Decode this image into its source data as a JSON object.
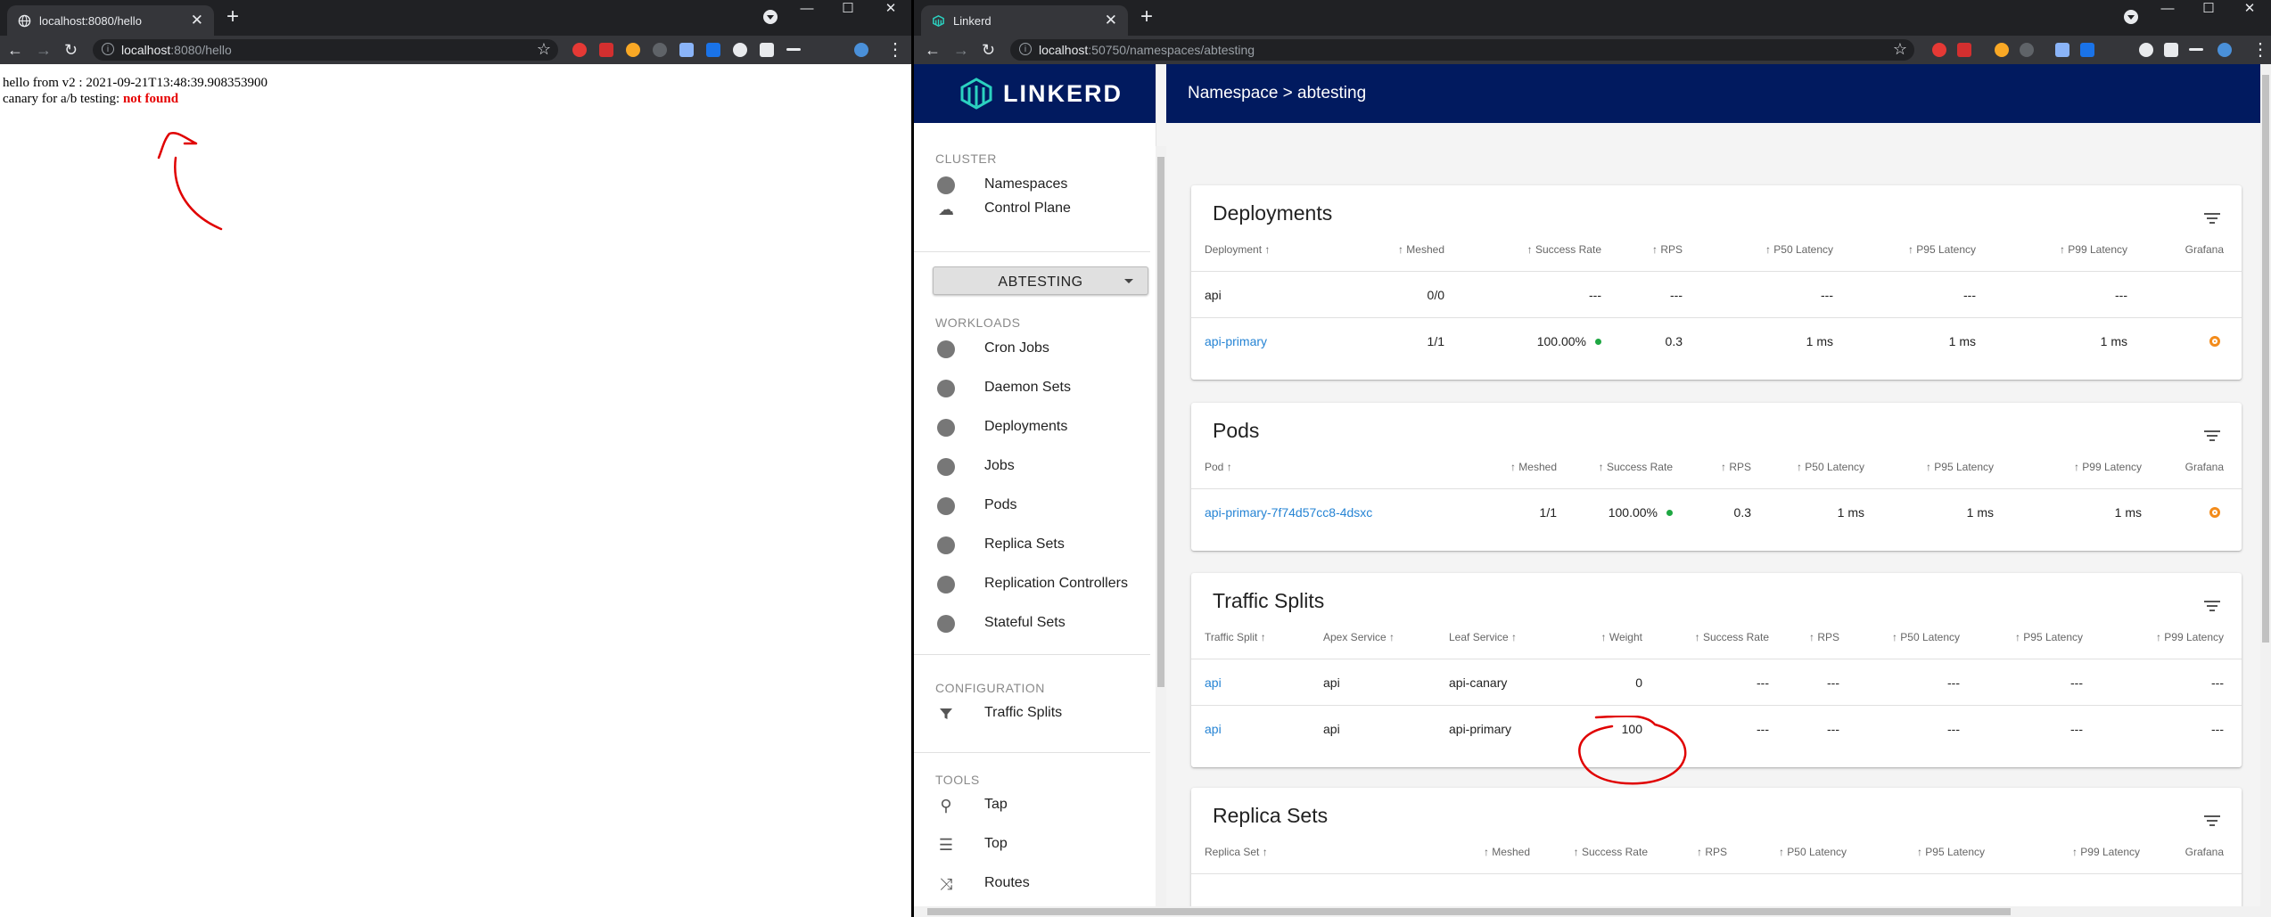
{
  "left_browser": {
    "tab_title": "localhost:8080/hello",
    "address": {
      "host": "localhost",
      "path": ":8080/hello"
    },
    "page": {
      "line1": "hello from v2 : 2021-09-21T13:48:39.908353900",
      "line2_prefix": "canary for a/b testing: ",
      "line2_value": "not found"
    }
  },
  "right_browser": {
    "tab_title": "Linkerd",
    "address": {
      "host": "localhost",
      "path": ":50750/namespaces/abtesting"
    }
  },
  "sidebar": {
    "brand": "LINKERD",
    "cluster_label": "CLUSTER",
    "cluster_items": [
      {
        "label": "Namespaces",
        "icon": "namespace-icon"
      },
      {
        "label": "Control Plane",
        "icon": "cloud-icon"
      }
    ],
    "namespace_select": "ABTESTING",
    "workloads_label": "WORKLOADS",
    "workload_items": [
      {
        "label": "Cron Jobs"
      },
      {
        "label": "Daemon Sets"
      },
      {
        "label": "Deployments"
      },
      {
        "label": "Jobs"
      },
      {
        "label": "Pods"
      },
      {
        "label": "Replica Sets"
      },
      {
        "label": "Replication Controllers"
      },
      {
        "label": "Stateful Sets"
      }
    ],
    "configuration_label": "CONFIGURATION",
    "configuration_items": [
      {
        "label": "Traffic Splits"
      }
    ],
    "tools_label": "TOOLS",
    "tools_items": [
      {
        "label": "Tap"
      },
      {
        "label": "Top"
      },
      {
        "label": "Routes"
      }
    ]
  },
  "breadcrumb": "Namespace > abtesting",
  "deployments": {
    "title": "Deployments",
    "headers": [
      "Deployment",
      "Meshed",
      "Success Rate",
      "RPS",
      "P50 Latency",
      "P95 Latency",
      "P99 Latency",
      "Grafana"
    ],
    "rows": [
      {
        "name": "api",
        "link": false,
        "meshed": "0/0",
        "success": "---",
        "rps": "---",
        "p50": "---",
        "p95": "---",
        "p99": "---",
        "grafana": false
      },
      {
        "name": "api-primary",
        "link": true,
        "meshed": "1/1",
        "success": "100.00%",
        "rps": "0.3",
        "p50": "1 ms",
        "p95": "1 ms",
        "p99": "1 ms",
        "grafana": true
      }
    ]
  },
  "pods": {
    "title": "Pods",
    "headers": [
      "Pod",
      "Meshed",
      "Success Rate",
      "RPS",
      "P50 Latency",
      "P95 Latency",
      "P99 Latency",
      "Grafana"
    ],
    "rows": [
      {
        "name": "api-primary-7f74d57cc8-4dsxc",
        "meshed": "1/1",
        "success": "100.00%",
        "rps": "0.3",
        "p50": "1 ms",
        "p95": "1 ms",
        "p99": "1 ms"
      }
    ]
  },
  "traffic_splits": {
    "title": "Traffic Splits",
    "headers": [
      "Traffic Split",
      "Apex Service",
      "Leaf Service",
      "Weight",
      "Success Rate",
      "RPS",
      "P50 Latency",
      "P95 Latency",
      "P99 Latency"
    ],
    "rows": [
      {
        "split": "api",
        "apex": "api",
        "leaf": "api-canary",
        "weight": "0",
        "success": "---",
        "rps": "---",
        "p50": "---",
        "p95": "---",
        "p99": "---"
      },
      {
        "split": "api",
        "apex": "api",
        "leaf": "api-primary",
        "weight": "100",
        "success": "---",
        "rps": "---",
        "p50": "---",
        "p95": "---",
        "p99": "---"
      }
    ]
  },
  "replica_sets": {
    "title": "Replica Sets",
    "headers": [
      "Replica Set",
      "Meshed",
      "Success Rate",
      "RPS",
      "P50 Latency",
      "P95 Latency",
      "P99 Latency",
      "Grafana"
    ]
  },
  "colors": {
    "navy": "#011a5f",
    "link": "#2684d4",
    "success_dot": "#1ea742",
    "annotation": "#e00000"
  }
}
